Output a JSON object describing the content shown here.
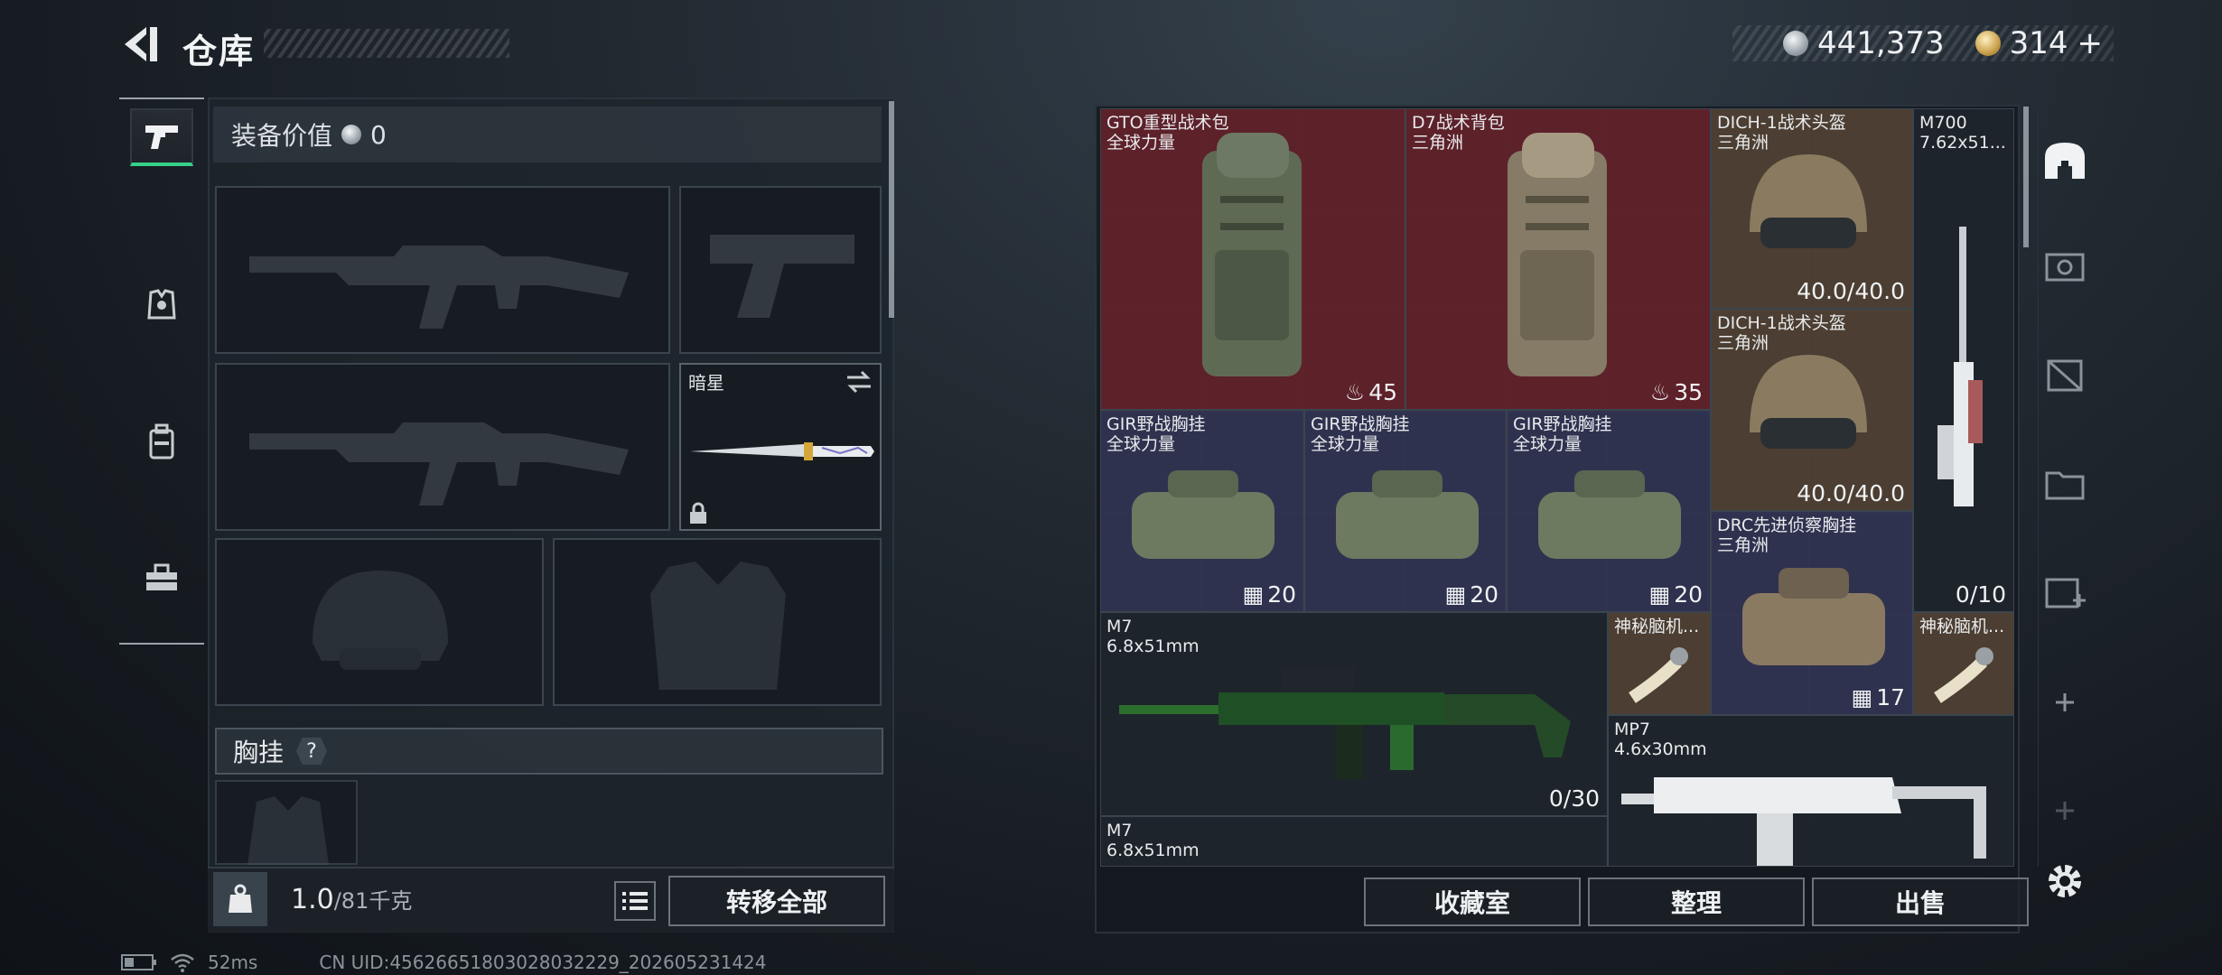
{
  "header": {
    "title": "仓库"
  },
  "currency": {
    "silver": "441,373",
    "gold": "314",
    "gold_add": "+"
  },
  "equipment": {
    "value_label": "装备价值",
    "value": "0",
    "melee_name": "暗星",
    "chest_rig_label": "胸挂",
    "chest_rig_help": "?"
  },
  "weight": {
    "current": "1.0",
    "max": "/81千克"
  },
  "buttons": {
    "transfer_all": "转移全部",
    "collection": "收藏室",
    "organize": "整理",
    "sell": "出售"
  },
  "inventory": [
    {
      "name": "GTO重型战术包",
      "sub": "全球力量",
      "value": "45",
      "value_icon": "backpack-icon",
      "rarity": "red"
    },
    {
      "name": "D7战术背包",
      "sub": "三角洲",
      "value": "35",
      "value_icon": "backpack-icon",
      "rarity": "red"
    },
    {
      "name": "DICH-1战术头盔",
      "sub": "三角洲",
      "value": "40.0/40.0",
      "rarity": "brown"
    },
    {
      "name": "M700",
      "sub": "7.62x51...",
      "value": "0/10",
      "rarity": "dark"
    },
    {
      "name": "DICH-1战术头盔",
      "sub": "三角洲",
      "value": "40.0/40.0",
      "rarity": "brown"
    },
    {
      "name": "GIR野战胸挂",
      "sub": "全球力量",
      "value": "20",
      "value_icon": "rig-icon",
      "rarity": "blue"
    },
    {
      "name": "GIR野战胸挂",
      "sub": "全球力量",
      "value": "20",
      "value_icon": "rig-icon",
      "rarity": "blue"
    },
    {
      "name": "GIR野战胸挂",
      "sub": "全球力量",
      "value": "20",
      "value_icon": "rig-icon",
      "rarity": "blue"
    },
    {
      "name": "DRC先进侦察胸挂",
      "sub": "三角洲",
      "value": "17",
      "value_icon": "rig-icon",
      "rarity": "blue"
    },
    {
      "name": "M7",
      "sub": "6.8x51mm",
      "value": "0/30",
      "rarity": "dark"
    },
    {
      "name": "神秘脑机...",
      "sub": "",
      "value": "",
      "rarity": "brown"
    },
    {
      "name": "神秘脑机...",
      "sub": "",
      "value": "",
      "rarity": "brown"
    },
    {
      "name": "MP7",
      "sub": "4.6x30mm",
      "value": "",
      "rarity": "dark"
    },
    {
      "name": "M7",
      "sub": "6.8x51mm",
      "value": "",
      "rarity": "dark"
    }
  ],
  "status": {
    "ping": "52ms",
    "uid": "CN UID:456266518030280322​29_202605231424"
  }
}
